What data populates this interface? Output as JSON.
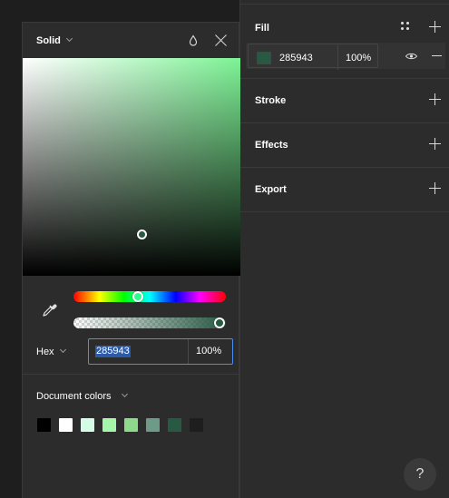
{
  "properties_panel": {
    "fill": {
      "title": "Fill",
      "hex": "285943",
      "opacity": "100%",
      "color": "#285943"
    },
    "sections": [
      {
        "title": "Stroke"
      },
      {
        "title": "Effects"
      },
      {
        "title": "Export"
      }
    ],
    "help_label": "?"
  },
  "color_picker": {
    "mode": "Solid",
    "current_color": "#285943",
    "hue_color": "#2dff8c",
    "format_label": "Hex",
    "hex_value": "285943",
    "opacity_value": "100%",
    "document_colors_label": "Document colors",
    "document_colors": [
      "#000000",
      "#ffffff",
      "#d5fde6",
      "#a4f7a9",
      "#8fd98d",
      "#6e9b87",
      "#285943",
      "#1e1e1e"
    ]
  },
  "icons": [
    "style-grid-icon",
    "add-icon",
    "eye-icon",
    "minus-icon",
    "drop-icon",
    "close-icon",
    "eyedropper-icon",
    "chevron-down-icon",
    "help-icon"
  ]
}
